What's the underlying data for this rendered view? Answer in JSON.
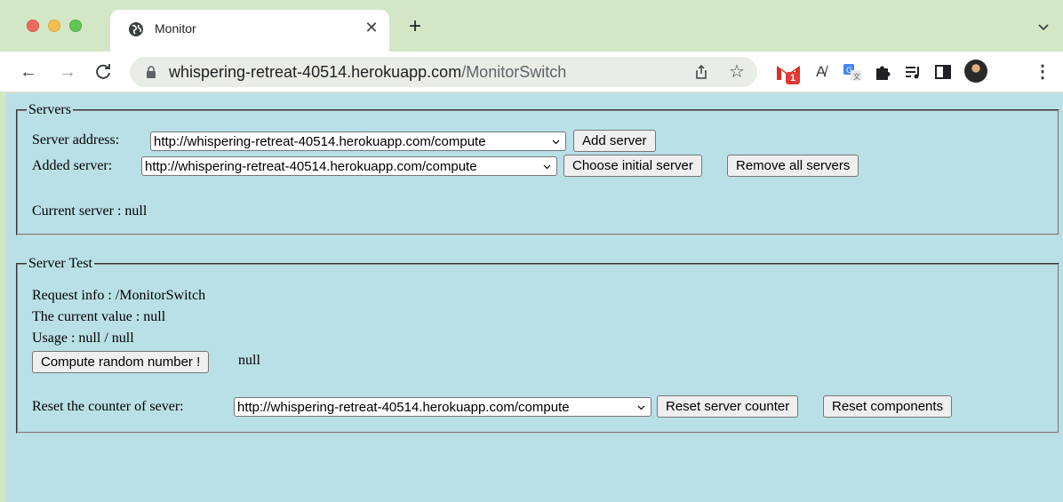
{
  "browser": {
    "tab_title": "Monitor",
    "url_host": "whispering-retreat-40514.herokuapp.com",
    "url_path": "/MonitorSwitch",
    "gmail_badge": "1"
  },
  "servers": {
    "legend": "Servers",
    "address_label": "Server address:",
    "address_value": "http://whispering-retreat-40514.herokuapp.com/compute",
    "add_button": "Add server",
    "added_label": "Added server:",
    "added_value": "http://whispering-retreat-40514.herokuapp.com/compute",
    "choose_button": "Choose initial server",
    "remove_button": "Remove all servers",
    "current_label": "Current server : null"
  },
  "test": {
    "legend": "Server Test",
    "request_info": "Request info : /MonitorSwitch",
    "current_value": "The current value : null",
    "usage": "Usage : null / null",
    "compute_button": "Compute random number !",
    "compute_result": "null",
    "reset_label": "Reset the counter of sever:",
    "reset_value": "http://whispering-retreat-40514.herokuapp.com/compute",
    "reset_counter_button": "Reset server counter",
    "reset_components_button": "Reset components"
  }
}
